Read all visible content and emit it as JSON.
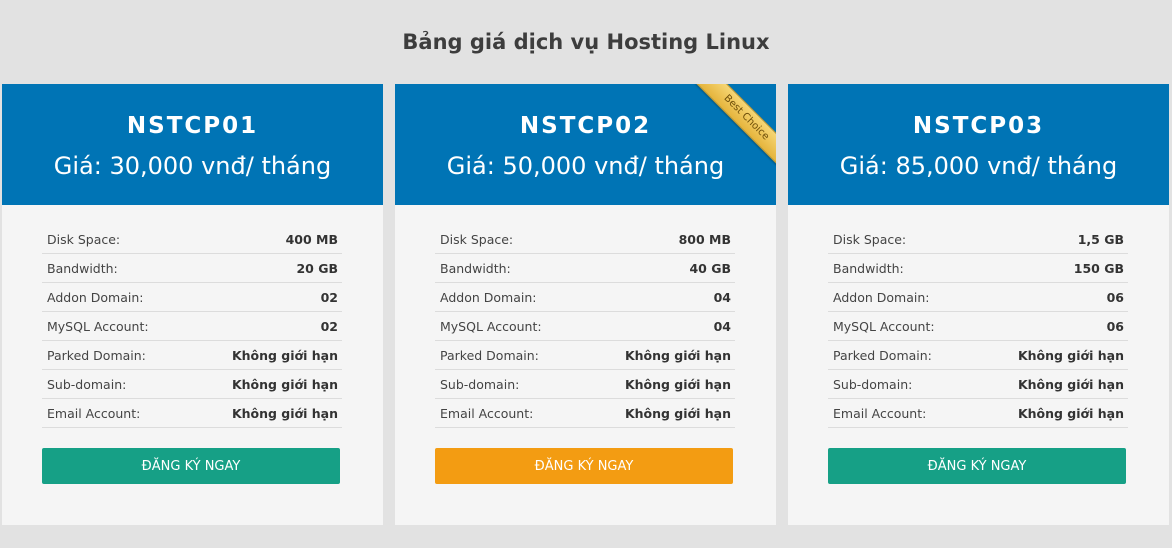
{
  "page_title": "Bảng giá dịch vụ Hosting Linux",
  "colors": {
    "background": "#e2e2e2",
    "header": "#0074b5",
    "card": "#f5f5f5",
    "button_green": "#16a086",
    "button_orange": "#f39c12"
  },
  "plans": [
    {
      "name": "NSTCP01",
      "price": "Giá: 30,000 vnđ/ tháng",
      "ribbon": "",
      "button_label": "ĐĂNG KÝ NGAY",
      "button_color": "#16a086",
      "features": [
        {
          "label": "Disk Space:",
          "value": "400 MB"
        },
        {
          "label": "Bandwidth:",
          "value": "20 GB"
        },
        {
          "label": "Addon Domain:",
          "value": "02"
        },
        {
          "label": "MySQL Account:",
          "value": "02"
        },
        {
          "label": "Parked Domain:",
          "value": "Không giới hạn"
        },
        {
          "label": "Sub-domain:",
          "value": "Không giới hạn"
        },
        {
          "label": "Email Account:",
          "value": "Không giới hạn"
        }
      ]
    },
    {
      "name": "NSTCP02",
      "price": "Giá: 50,000 vnđ/ tháng",
      "ribbon": "Best Choice",
      "button_label": "ĐĂNG KÝ NGAY",
      "button_color": "#f39c12",
      "features": [
        {
          "label": "Disk Space:",
          "value": "800 MB"
        },
        {
          "label": "Bandwidth:",
          "value": "40 GB"
        },
        {
          "label": "Addon Domain:",
          "value": "04"
        },
        {
          "label": "MySQL Account:",
          "value": "04"
        },
        {
          "label": "Parked Domain:",
          "value": "Không giới hạn"
        },
        {
          "label": "Sub-domain:",
          "value": "Không giới hạn"
        },
        {
          "label": "Email Account:",
          "value": "Không giới hạn"
        }
      ]
    },
    {
      "name": "NSTCP03",
      "price": "Giá: 85,000 vnđ/ tháng",
      "ribbon": "",
      "button_label": "ĐĂNG KÝ NGAY",
      "button_color": "#16a086",
      "features": [
        {
          "label": "Disk Space:",
          "value": "1,5 GB"
        },
        {
          "label": "Bandwidth:",
          "value": "150 GB"
        },
        {
          "label": "Addon Domain:",
          "value": "06"
        },
        {
          "label": "MySQL Account:",
          "value": "06"
        },
        {
          "label": "Parked Domain:",
          "value": "Không giới hạn"
        },
        {
          "label": "Sub-domain:",
          "value": "Không giới hạn"
        },
        {
          "label": "Email Account:",
          "value": "Không giới hạn"
        }
      ]
    }
  ]
}
